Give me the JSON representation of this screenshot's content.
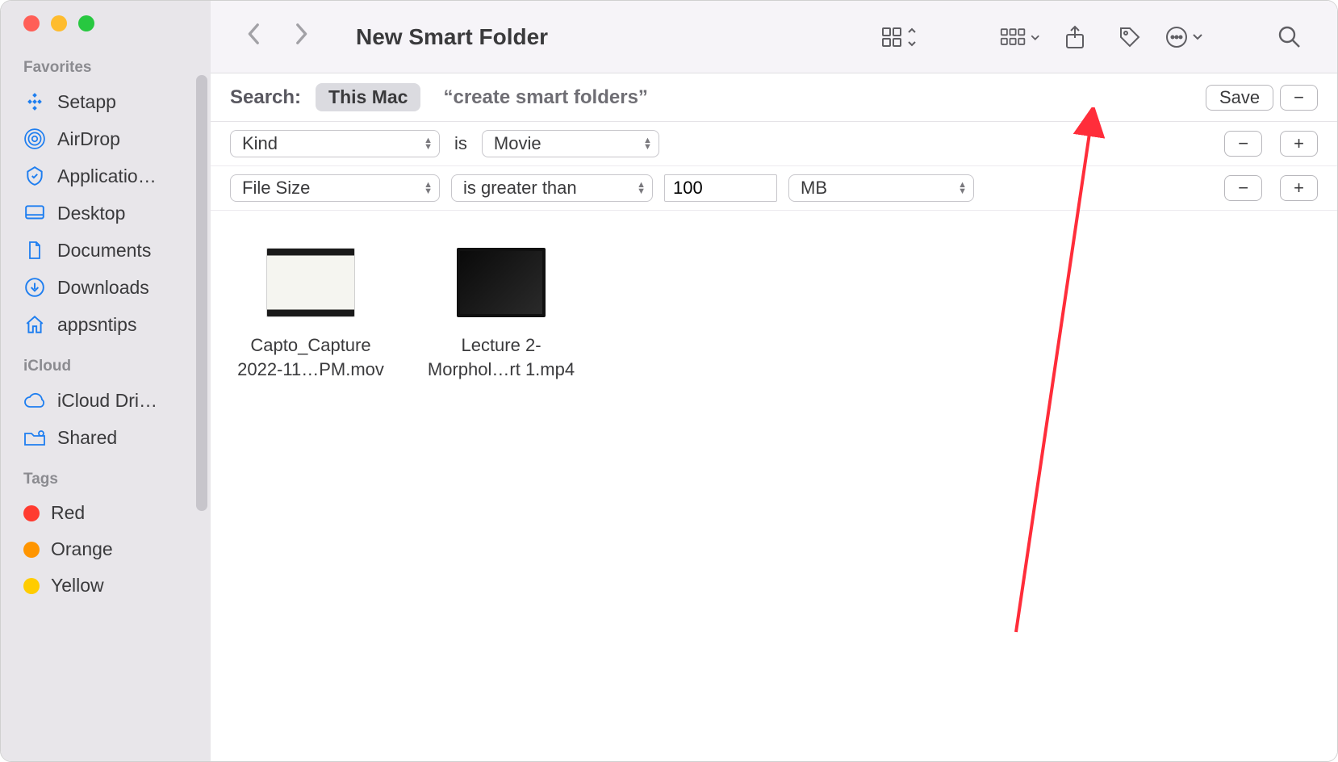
{
  "sidebar": {
    "sections": {
      "favorites": {
        "title": "Favorites",
        "items": [
          "Setapp",
          "AirDrop",
          "Applicatio…",
          "Desktop",
          "Documents",
          "Downloads",
          "appsntips"
        ]
      },
      "icloud": {
        "title": "iCloud",
        "items": [
          "iCloud Dri…",
          "Shared"
        ]
      },
      "tags": {
        "title": "Tags",
        "items": [
          {
            "label": "Red",
            "color": "#ff3b30"
          },
          {
            "label": "Orange",
            "color": "#ff9500"
          },
          {
            "label": "Yellow",
            "color": "#ffcc00"
          }
        ]
      }
    }
  },
  "toolbar": {
    "title": "New Smart Folder"
  },
  "searchbar": {
    "label": "Search:",
    "scope_selected": "This Mac",
    "scope_text": "“create smart folders”",
    "save_label": "Save",
    "minus_label": "−"
  },
  "criteria": [
    {
      "attr": "Kind",
      "middle_word": "is",
      "value_combo": "Movie"
    },
    {
      "attr": "File Size",
      "op": "is greater than",
      "value_text": "100",
      "unit": "MB"
    }
  ],
  "row_buttons": {
    "minus": "−",
    "plus": "+"
  },
  "files": [
    {
      "name_l1": "Capto_Capture",
      "name_l2": "2022-11…PM.mov"
    },
    {
      "name_l1": "Lecture 2-",
      "name_l2": "Morphol…rt 1.mp4"
    }
  ]
}
